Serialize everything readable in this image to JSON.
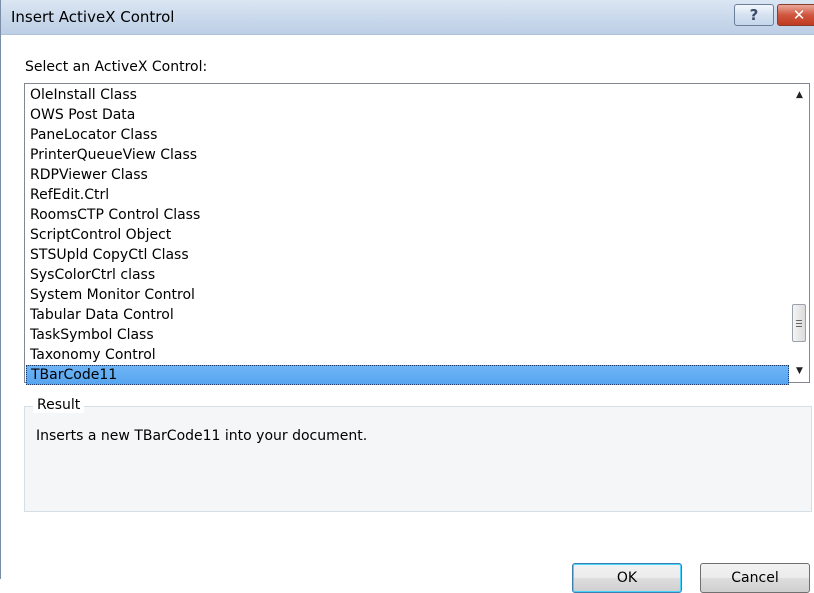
{
  "window": {
    "title": "Insert ActiveX Control",
    "help_glyph": "?",
    "close_glyph": "✕"
  },
  "list": {
    "label": "Select an ActiveX Control:",
    "items": [
      "OleInstall Class",
      "OWS Post Data",
      "PaneLocator Class",
      "PrinterQueueView Class",
      "RDPViewer Class",
      "RefEdit.Ctrl",
      "RoomsCTP Control Class",
      "ScriptControl Object",
      "STSUpld CopyCtl Class",
      "SysColorCtrl class",
      "System Monitor Control",
      "Tabular Data Control",
      "TaskSymbol Class",
      "Taxonomy Control",
      "TBarCode11"
    ],
    "selected": "TBarCode11"
  },
  "result": {
    "legend": "Result",
    "text": "Inserts a new TBarCode11 into your document."
  },
  "buttons": {
    "ok": "OK",
    "cancel": "Cancel"
  },
  "colors": {
    "selection": "#56a5f0",
    "titlebar": "#c9d8eb",
    "close": "#c13a22"
  }
}
